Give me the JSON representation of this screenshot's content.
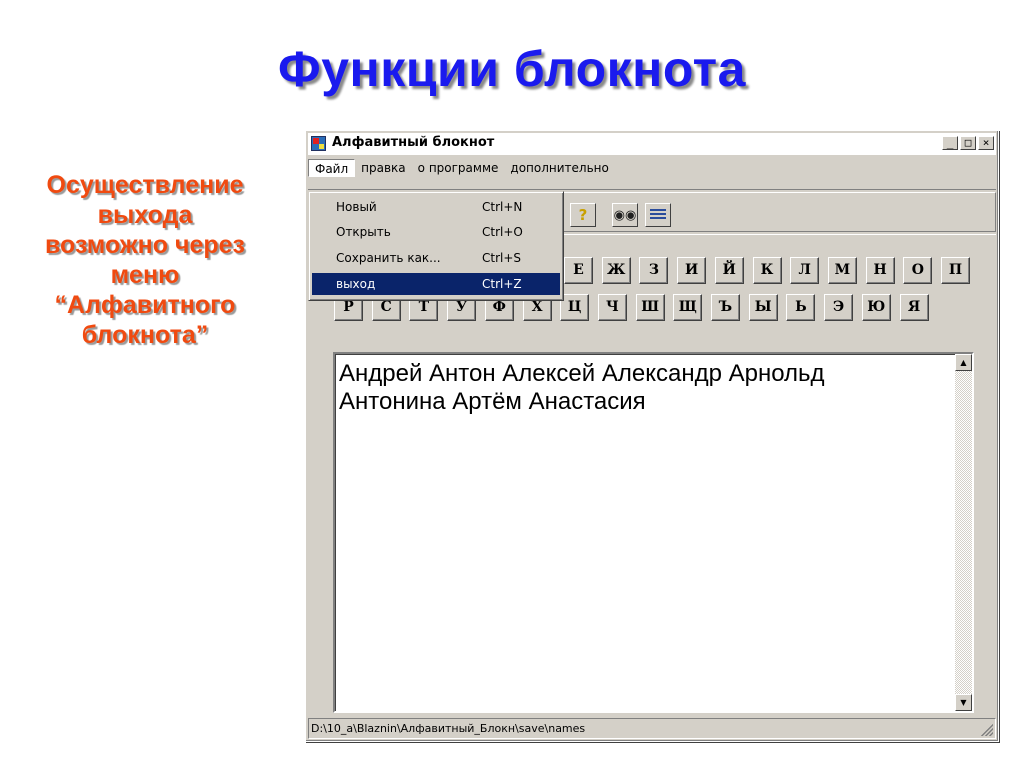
{
  "slide": {
    "title": "Функции блокнота",
    "note_lines": [
      "Осуществление",
      "выхода",
      "возможно через",
      "меню",
      "“Алфавитного",
      "блокнота”"
    ]
  },
  "window": {
    "title": "Алфавитный блокнот",
    "controls": [
      "_",
      "□",
      "×"
    ],
    "menu": [
      "Файл",
      "правка",
      "о программе",
      "дополнительно"
    ],
    "toolbar_icons": [
      "help-icon",
      "find-icon",
      "list-icon"
    ]
  },
  "file_menu": {
    "items": [
      {
        "label": "Новый",
        "shortcut": "Ctrl+N"
      },
      {
        "label": "Открыть",
        "shortcut": "Ctrl+O"
      },
      {
        "label": "Сохранить как...",
        "shortcut": "Ctrl+S"
      },
      {
        "label": "выход",
        "shortcut": "Ctrl+Z"
      }
    ],
    "selected_index": 3
  },
  "letters": {
    "row1": [
      "Е",
      "Ж",
      "З",
      "И",
      "Й",
      "К",
      "Л",
      "М",
      "Н",
      "О",
      "П"
    ],
    "row2": [
      "Р",
      "С",
      "Т",
      "У",
      "Ф",
      "Х",
      "Ц",
      "Ч",
      "Ш",
      "Щ",
      "Ъ",
      "Ы",
      "Ь",
      "Э",
      "Ю",
      "Я"
    ]
  },
  "editor": {
    "line1": "Андрей Антон Алексей Александр Арнольд",
    "line2": "Антонина Артём Анастасия"
  },
  "status": {
    "path": "D:\\10_а\\Blaznin\\Алфавитный_Блокн\\save\\names"
  },
  "colors": {
    "title": "#1a1aee",
    "note": "#f04a10",
    "selection": "#0a246a",
    "face": "#d4d0c8"
  }
}
